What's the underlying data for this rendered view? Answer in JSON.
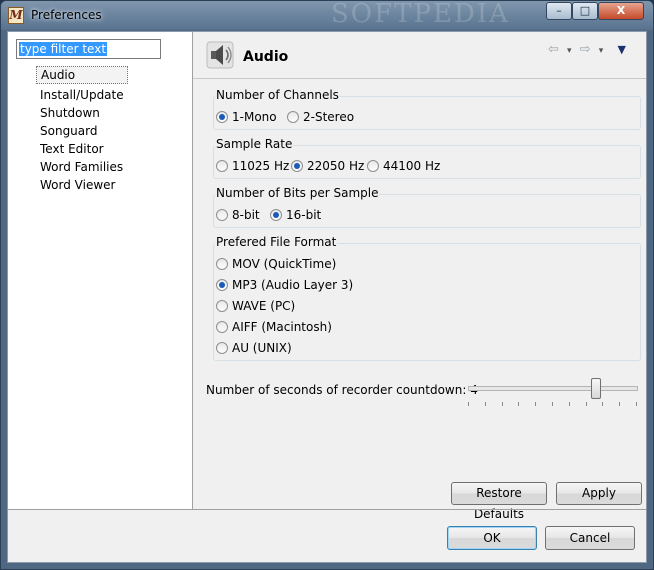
{
  "window": {
    "title": "Preferences",
    "watermark": "SOFTPEDIA",
    "controls": {
      "minimize": "–",
      "maximize": "□",
      "close": "X"
    }
  },
  "filter": {
    "text": "type filter text"
  },
  "tree": {
    "items": [
      {
        "label": "Audio",
        "selected": true
      },
      {
        "label": "Install/Update"
      },
      {
        "label": "Shutdown"
      },
      {
        "label": "Songuard"
      },
      {
        "label": "Text Editor"
      },
      {
        "label": "Word Families"
      },
      {
        "label": "Word Viewer"
      }
    ]
  },
  "page": {
    "title": "Audio",
    "icon": "speaker-icon",
    "nav": {
      "back": "⇦",
      "forward": "⇨",
      "dropdown": "▾",
      "menu": "▼"
    }
  },
  "channels": {
    "label": "Number of Channels",
    "options": [
      "1-Mono",
      "2-Stereo"
    ],
    "selected": 0
  },
  "sample_rate": {
    "label": "Sample Rate",
    "options": [
      "11025 Hz",
      "22050 Hz",
      "44100 Hz"
    ],
    "selected": 1
  },
  "bits": {
    "label": "Number of Bits per Sample",
    "options": [
      "8-bit",
      "16-bit"
    ],
    "selected": 1
  },
  "file_format": {
    "label": "Prefered File Format",
    "options": [
      "MOV (QuickTime)",
      "MP3 (Audio Layer 3)",
      "WAVE (PC)",
      "AIFF (Macintosh)",
      "AU (UNIX)"
    ],
    "selected": 1
  },
  "countdown": {
    "label": "Number of seconds of recorder countdown: 4",
    "value": 4,
    "fraction": 0.78
  },
  "buttons": {
    "restore_defaults": "Restore Defaults",
    "apply": "Apply",
    "ok": "OK",
    "cancel": "Cancel"
  },
  "colors": {
    "selection": "#3399ff",
    "radio_dot": "#1a5bb8",
    "default_button_border": "#3c7fb1"
  }
}
